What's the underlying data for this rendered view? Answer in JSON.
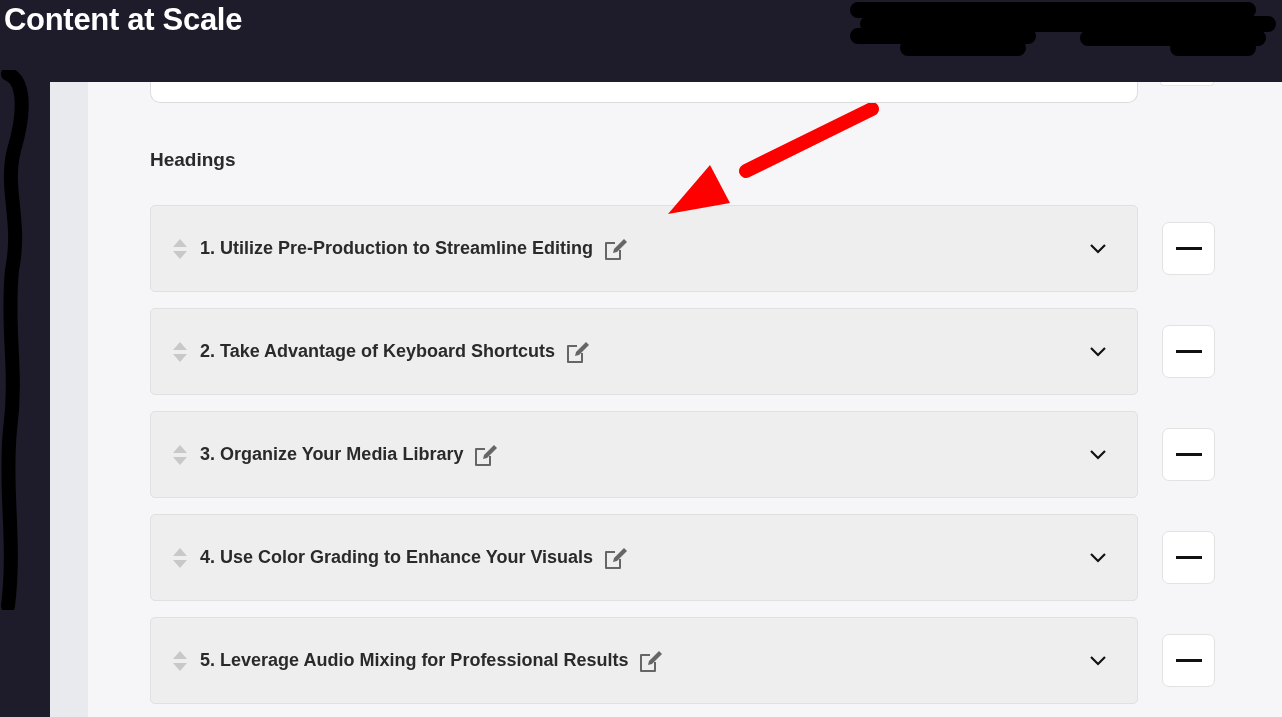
{
  "header": {
    "title": "Content at Scale"
  },
  "section": {
    "title": "Headings"
  },
  "headings": [
    {
      "text": "1. Utilize Pre-Production to Streamline Editing"
    },
    {
      "text": "2. Take Advantage of Keyboard Shortcuts"
    },
    {
      "text": "3. Organize Your Media Library"
    },
    {
      "text": "4. Use Color Grading to Enhance Your Visuals"
    },
    {
      "text": "5. Leverage Audio Mixing for Professional Results"
    }
  ]
}
